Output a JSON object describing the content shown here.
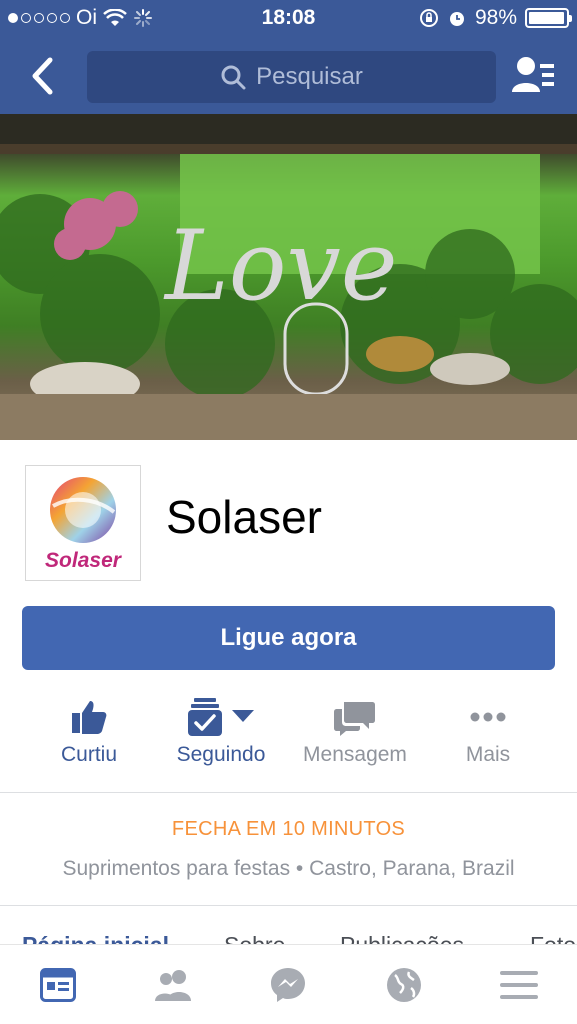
{
  "status_bar": {
    "carrier": "Oi",
    "time": "18:08",
    "battery": "98%",
    "battery_level": 0.98
  },
  "nav": {
    "search_placeholder": "Pesquisar",
    "icons": [
      "back-arrow-icon",
      "search-icon",
      "friend-requests-icon"
    ]
  },
  "page": {
    "name": "Solaser",
    "logo_text": "Solaser",
    "cover_text": "Love"
  },
  "cta": {
    "label": "Ligue agora"
  },
  "actions": [
    {
      "label": "Curtiu",
      "icon": "thumbs-up-icon",
      "color": "#3b5998"
    },
    {
      "label": "Seguindo",
      "icon": "following-check-icon",
      "color": "#3b5998"
    },
    {
      "label": "Mensagem",
      "icon": "message-bubbles-icon",
      "color": "#90949c"
    },
    {
      "label": "Mais",
      "icon": "more-dots-icon",
      "color": "#90949c"
    }
  ],
  "info": {
    "hours": "FECHA EM 10 MINUTOS",
    "category": "Suprimentos para festas",
    "location": "Castro, Parana, Brazil"
  },
  "tabs": [
    "Página inicial",
    "Sobre",
    "Publicações",
    "Fotos"
  ],
  "bottom_nav": [
    "news-feed-icon",
    "friends-icon",
    "messenger-icon",
    "globe-icon",
    "menu-icon"
  ],
  "colors": {
    "brand": "#3b5998",
    "cta": "#4267b2",
    "hours": "#f7923a",
    "muted": "#90949c"
  }
}
